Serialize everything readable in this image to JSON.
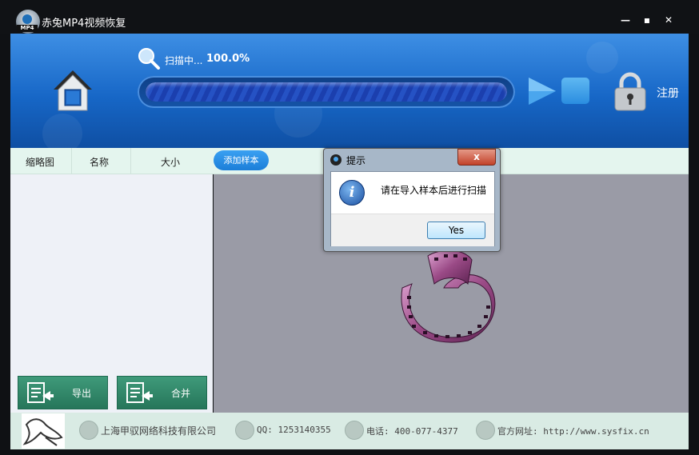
{
  "app": {
    "title": "赤兔MP4视频恢复",
    "logo_tag": "MP4"
  },
  "window_controls": {
    "minimize": "—",
    "maximize": "▪",
    "close": "✕"
  },
  "scan": {
    "status_label": "扫描中...",
    "percent_text": "100.0%",
    "progress_fraction": 1.0
  },
  "header": {
    "register_label": "注册"
  },
  "columns": {
    "thumbnail": "缩略图",
    "name": "名称",
    "size": "大小",
    "add_sample": "添加样本"
  },
  "buttons": {
    "export": "导出",
    "merge": "合并"
  },
  "dialog": {
    "title": "提示",
    "close": "x",
    "message": "请在导入样本后进行扫描",
    "yes": "Yes"
  },
  "footer": {
    "company": "上海甲驭网络科技有限公司",
    "qq": "QQ: 1253140355",
    "phone": "电话: 400-077-4377",
    "website": "官方网址: http://www.sysfix.cn"
  },
  "icons": [
    "app-logo-icon",
    "home-icon",
    "search-icon",
    "play-icon",
    "stop-icon",
    "lock-icon",
    "export-icon",
    "merge-icon",
    "info-icon",
    "film-reel-icon",
    "company-icon",
    "qq-icon",
    "phone-icon",
    "globe-icon"
  ],
  "colors": {
    "header_blue": "#1767c7",
    "green_button": "#2f8a69",
    "panel_gray": "#9a9ba6",
    "footer": "#d9ebe4"
  }
}
